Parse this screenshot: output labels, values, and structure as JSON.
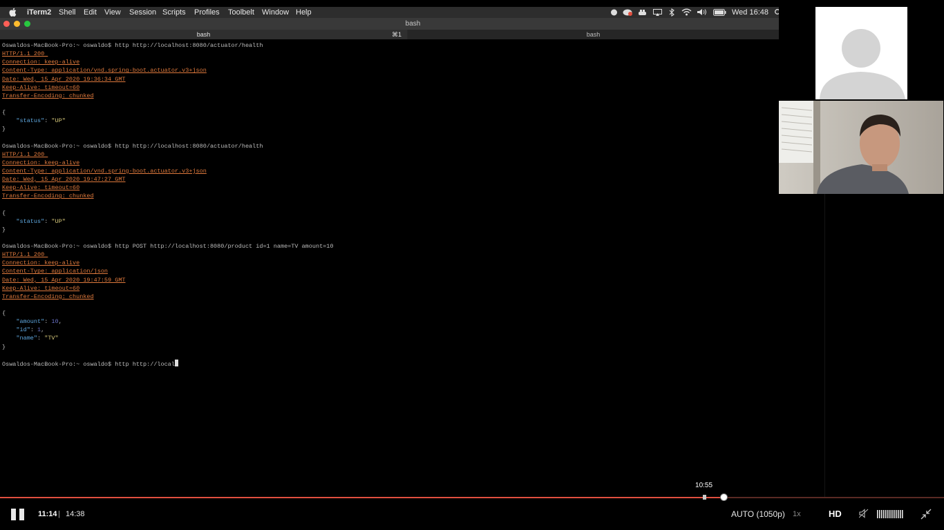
{
  "menubar": {
    "app": "iTerm2",
    "items": [
      "Shell",
      "Edit",
      "View",
      "Session",
      "Scripts",
      "Profiles",
      "Toolbelt",
      "Window",
      "Help"
    ],
    "clock": "Wed 16:48"
  },
  "window": {
    "title": "bash"
  },
  "tabs": [
    {
      "label": "bash",
      "shortcut": "⌘1"
    },
    {
      "label": "bash"
    }
  ],
  "terminal": {
    "lines": [
      [
        {
          "t": "Oswaldos-MacBook-Pro:~ oswaldo$ http http://localhost:8080/actuator/health",
          "c": "plain"
        }
      ],
      [
        {
          "t": "HTTP/1.1 200 ",
          "c": "hdr"
        }
      ],
      [
        {
          "t": "Connection: keep-alive",
          "c": "hdr"
        }
      ],
      [
        {
          "t": "Content-Type: application/vnd.spring-boot.actuator.v3+json",
          "c": "hdr"
        }
      ],
      [
        {
          "t": "Date: Wed, 15 Apr 2020 19:36:34 GMT",
          "c": "hdr"
        }
      ],
      [
        {
          "t": "Keep-Alive: timeout=60",
          "c": "hdr"
        }
      ],
      [
        {
          "t": "Transfer-Encoding: chunked",
          "c": "hdr"
        }
      ],
      [],
      [
        {
          "t": "{",
          "c": "plain"
        }
      ],
      [
        {
          "t": "    ",
          "c": "plain"
        },
        {
          "t": "\"status\"",
          "c": "key"
        },
        {
          "t": ": ",
          "c": "plain"
        },
        {
          "t": "\"UP\"",
          "c": "str"
        }
      ],
      [
        {
          "t": "}",
          "c": "plain"
        }
      ],
      [],
      [
        {
          "t": "Oswaldos-MacBook-Pro:~ oswaldo$ http http://localhost:8080/actuator/health",
          "c": "plain"
        }
      ],
      [
        {
          "t": "HTTP/1.1 200 ",
          "c": "hdr"
        }
      ],
      [
        {
          "t": "Connection: keep-alive",
          "c": "hdr"
        }
      ],
      [
        {
          "t": "Content-Type: application/vnd.spring-boot.actuator.v3+json",
          "c": "hdr"
        }
      ],
      [
        {
          "t": "Date: Wed, 15 Apr 2020 19:47:27 GMT",
          "c": "hdr"
        }
      ],
      [
        {
          "t": "Keep-Alive: timeout=60",
          "c": "hdr"
        }
      ],
      [
        {
          "t": "Transfer-Encoding: chunked",
          "c": "hdr"
        }
      ],
      [],
      [
        {
          "t": "{",
          "c": "plain"
        }
      ],
      [
        {
          "t": "    ",
          "c": "plain"
        },
        {
          "t": "\"status\"",
          "c": "key"
        },
        {
          "t": ": ",
          "c": "plain"
        },
        {
          "t": "\"UP\"",
          "c": "str"
        }
      ],
      [
        {
          "t": "}",
          "c": "plain"
        }
      ],
      [],
      [
        {
          "t": "Oswaldos-MacBook-Pro:~ oswaldo$ http POST http://localhost:8080/product id=1 name=TV amount=10",
          "c": "plain"
        }
      ],
      [
        {
          "t": "HTTP/1.1 200 ",
          "c": "hdr"
        }
      ],
      [
        {
          "t": "Connection: keep-alive",
          "c": "hdr"
        }
      ],
      [
        {
          "t": "Content-Type: application/json",
          "c": "hdr"
        }
      ],
      [
        {
          "t": "Date: Wed, 15 Apr 2020 19:47:59 GMT",
          "c": "hdr"
        }
      ],
      [
        {
          "t": "Keep-Alive: timeout=60",
          "c": "hdr"
        }
      ],
      [
        {
          "t": "Transfer-Encoding: chunked",
          "c": "hdr"
        }
      ],
      [],
      [
        {
          "t": "{",
          "c": "plain"
        }
      ],
      [
        {
          "t": "    ",
          "c": "plain"
        },
        {
          "t": "\"amount\"",
          "c": "key"
        },
        {
          "t": ": ",
          "c": "plain"
        },
        {
          "t": "10",
          "c": "num"
        },
        {
          "t": ",",
          "c": "plain"
        }
      ],
      [
        {
          "t": "    ",
          "c": "plain"
        },
        {
          "t": "\"id\"",
          "c": "key"
        },
        {
          "t": ": ",
          "c": "plain"
        },
        {
          "t": "1",
          "c": "num"
        },
        {
          "t": ",",
          "c": "plain"
        }
      ],
      [
        {
          "t": "    ",
          "c": "plain"
        },
        {
          "t": "\"name\"",
          "c": "key"
        },
        {
          "t": ": ",
          "c": "plain"
        },
        {
          "t": "\"TV\"",
          "c": "str"
        }
      ],
      [
        {
          "t": "}",
          "c": "plain"
        }
      ],
      [],
      [
        {
          "t": "Oswaldos-MacBook-Pro:~ oswaldo$ http http://local",
          "c": "plain"
        },
        {
          "t": "",
          "c": "cursor"
        }
      ]
    ]
  },
  "player": {
    "current_time": "11:14",
    "separator": "|",
    "duration": "14:38",
    "progress_fraction": 0.767,
    "hover_time": "10:55",
    "hover_fraction": 0.746,
    "quality": "AUTO (1050p)",
    "speed": "1x",
    "hd_label": "HD"
  },
  "colors": {
    "progress": "#e14f3f",
    "header_text": "#e07a3d",
    "json_key": "#5fa8e0",
    "json_string": "#d6c87a"
  }
}
